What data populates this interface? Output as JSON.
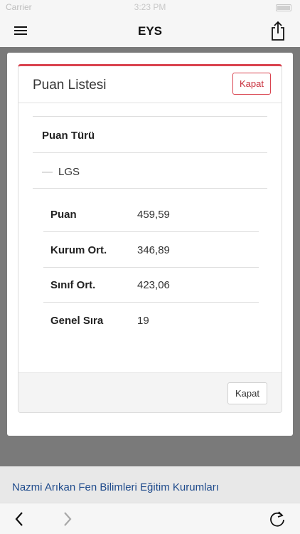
{
  "status_bar": {
    "carrier": "Carrier",
    "time": "3:23 PM"
  },
  "nav": {
    "title": "EYS",
    "menu_icon": "hamburger-icon",
    "share_icon": "share-icon"
  },
  "modal": {
    "title": "Puan Listesi",
    "close_top_label": "Kapat",
    "close_bottom_label": "Kapat",
    "accent_color": "#d9434f",
    "type_header": "Puan Türü",
    "type_item": "LGS",
    "scores": [
      {
        "label": "Puan",
        "value": "459,59"
      },
      {
        "label": "Kurum Ort.",
        "value": "346,89"
      },
      {
        "label": "Sınıf Ort.",
        "value": "423,06"
      },
      {
        "label": "Genel Sıra",
        "value": "19"
      }
    ]
  },
  "footer": {
    "link_text": "Nazmi Arıkan Fen Bilimleri Eğitim Kurumları",
    "link_color": "#1f4b8c"
  },
  "toolbar": {
    "back_icon": "chevron-left-icon",
    "forward_icon": "chevron-right-icon",
    "reload_icon": "reload-icon"
  }
}
